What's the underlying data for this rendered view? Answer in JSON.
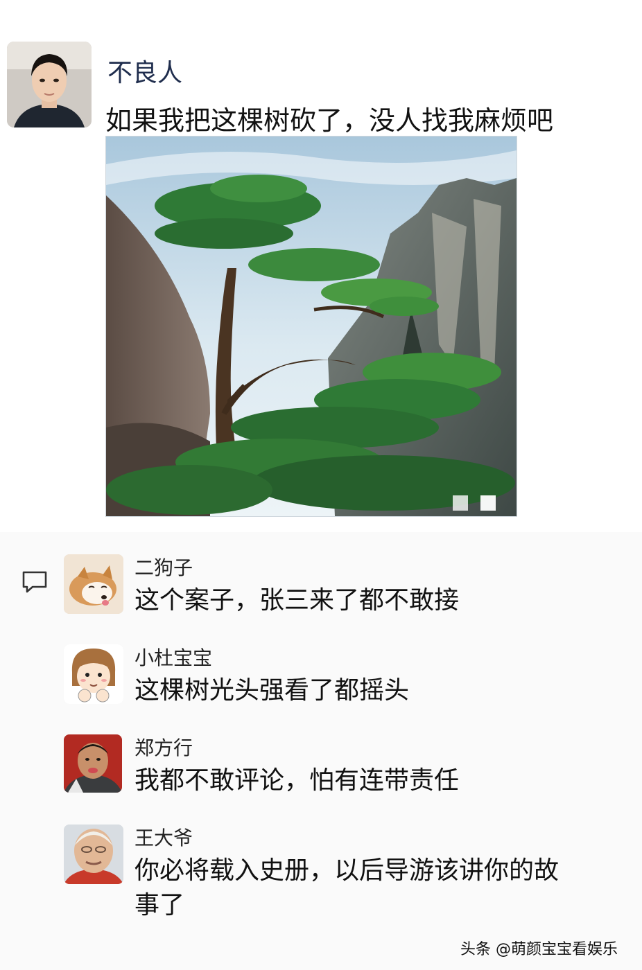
{
  "post": {
    "author": "不良人",
    "text": "如果我把这棵树砍了，没人找我麻烦吧",
    "avatar_icon": "man-portrait-avatar",
    "image_icon": "welcoming-pine-tree-photo"
  },
  "comment_section": {
    "icon": "comment-bubble-icon",
    "items": [
      {
        "name": "二狗子",
        "text": "这个案子，张三来了都不敢接",
        "avatar_icon": "sleeping-shiba-dog-avatar"
      },
      {
        "name": "小杜宝宝",
        "text": "这棵树光头强看了都摇头",
        "avatar_icon": "cartoon-girl-avatar"
      },
      {
        "name": "郑方行",
        "text": "我都不敢评论，怕有连带责任",
        "avatar_icon": "man-face-avatar"
      },
      {
        "name": "王大爷",
        "text": "你必将载入史册，以后导游该讲你的故事了",
        "avatar_icon": "old-man-avatar"
      }
    ]
  },
  "watermark": "头条 @萌颜宝宝看娱乐",
  "colors": {
    "author_name": "#1f2d4d",
    "comments_bg": "#fafafa"
  }
}
